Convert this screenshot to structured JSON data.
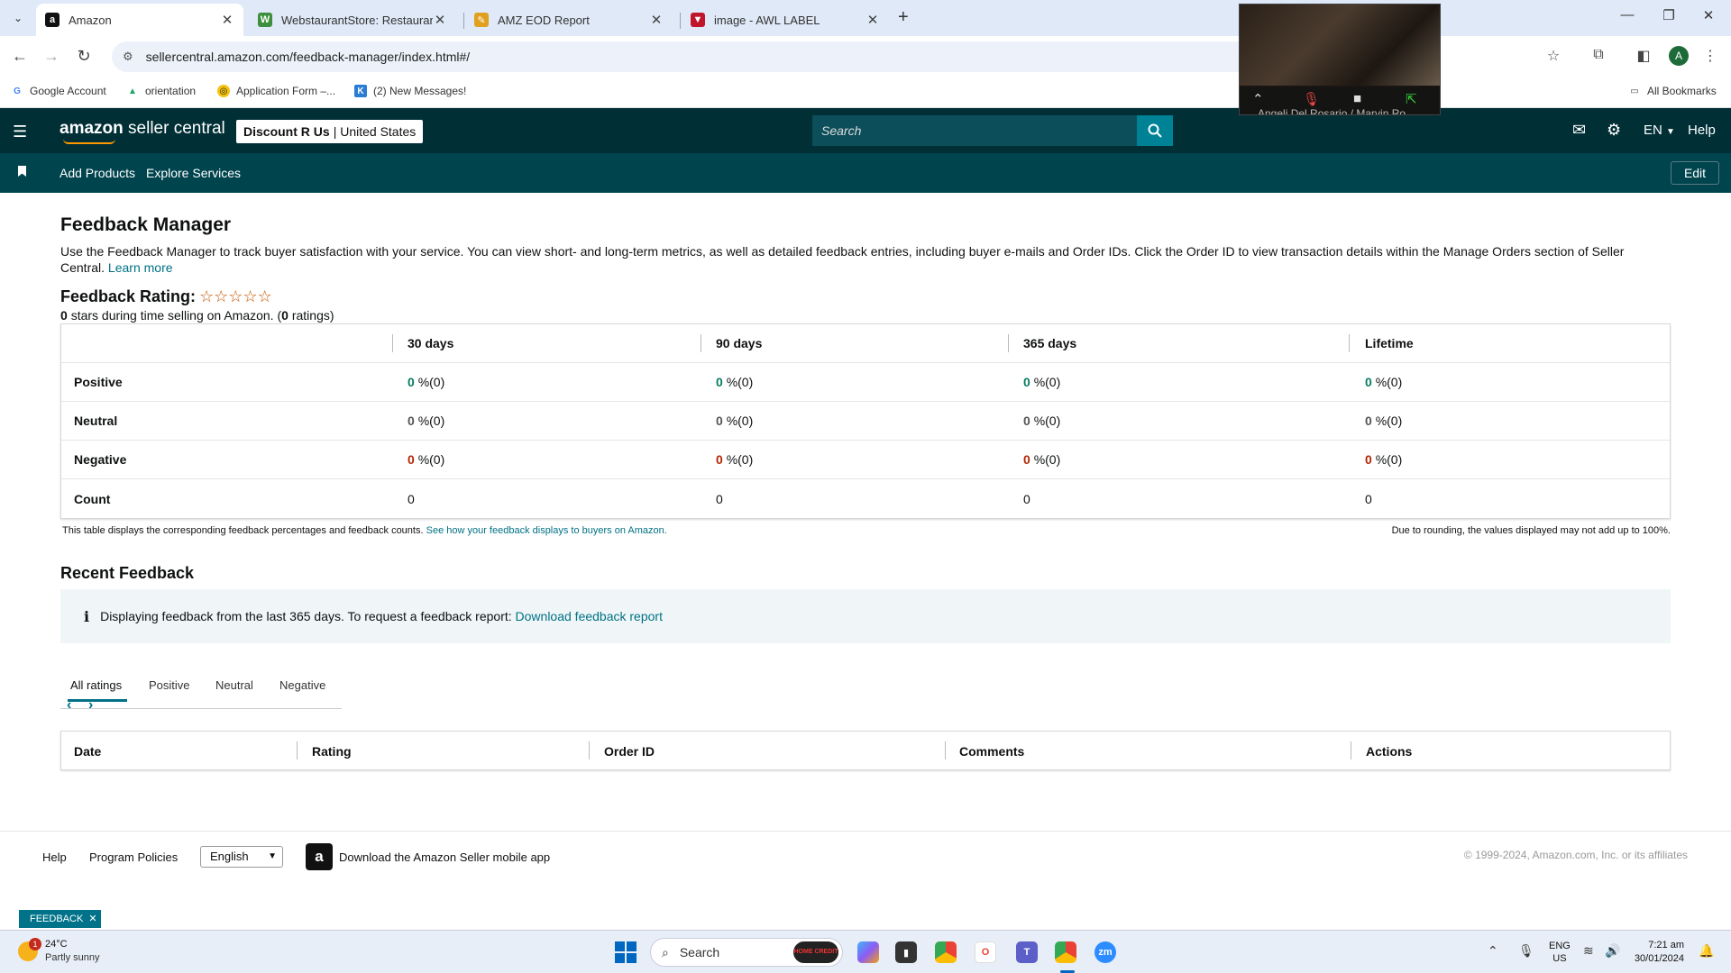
{
  "browser": {
    "tabs": [
      {
        "title": "Amazon",
        "favicon": "a",
        "favicon_color": "#111111",
        "active": true
      },
      {
        "title": "WebstaurantStore: Restaurant S",
        "favicon": "W",
        "favicon_color": "#3c8f3c",
        "active": false
      },
      {
        "title": "AMZ EOD Report",
        "favicon": "✎",
        "favicon_color": "#e0a020",
        "active": false
      },
      {
        "title": "image - AWL LABEL",
        "favicon": "▼",
        "favicon_color": "#c0152b",
        "active": false
      }
    ],
    "new_tab": "+",
    "url": "sellercentral.amazon.com/feedback-manager/index.html#/",
    "profile_initial": "A",
    "bookmarks": [
      "Google Account",
      "orientation",
      "Application Form –...",
      "(2) New Messages!"
    ],
    "all_bookmarks": "All Bookmarks"
  },
  "zoom_overlay": {
    "participants": "Angeli Del Rosario / Marvin Ro..."
  },
  "header": {
    "logo_primary": "amazon",
    "logo_secondary": "seller central",
    "store_name": "Discount R Us",
    "store_region": "United States",
    "search_placeholder": "Search",
    "language": "EN",
    "help": "Help"
  },
  "subnav": {
    "links": [
      "Add Products",
      "Explore Services"
    ],
    "edit": "Edit"
  },
  "page": {
    "title": "Feedback Manager",
    "description": "Use the Feedback Manager to track buyer satisfaction with your service. You can view short- and long-term metrics, as well as detailed feedback entries, including buyer e-mails and Order IDs. Click the Order ID to view transaction details within the Manage Orders section of Seller Central.",
    "learn_more": "Learn more",
    "rating_title": "Feedback Rating:",
    "stars": "☆☆☆☆☆",
    "rating_stars_value": "0",
    "rating_mid": "stars during time selling on Amazon. (",
    "rating_count": "0",
    "rating_end": "ratings)"
  },
  "feedback_table": {
    "columns": [
      "30 days",
      "90 days",
      "365 days",
      "Lifetime"
    ],
    "rows": [
      {
        "label": "Positive",
        "kind": "pos",
        "values": [
          "0",
          "0",
          "0",
          "0"
        ],
        "counts": [
          "%(0)",
          "%(0)",
          "%(0)",
          "%(0)"
        ]
      },
      {
        "label": "Neutral",
        "kind": "neu",
        "values": [
          "0",
          "0",
          "0",
          "0"
        ],
        "counts": [
          "%(0)",
          "%(0)",
          "%(0)",
          "%(0)"
        ]
      },
      {
        "label": "Negative",
        "kind": "neg",
        "values": [
          "0",
          "0",
          "0",
          "0"
        ],
        "counts": [
          "%(0)",
          "%(0)",
          "%(0)",
          "%(0)"
        ]
      },
      {
        "label": "Count",
        "kind": "count",
        "values": [
          "0",
          "0",
          "0",
          "0"
        ],
        "counts": [
          "",
          "",
          "",
          ""
        ]
      }
    ],
    "note_left": "This table displays the corresponding feedback percentages and feedback counts.",
    "note_link": "See how your feedback displays to buyers on Amazon.",
    "note_right": "Due to rounding, the values displayed may not add up to 100%."
  },
  "recent_feedback": {
    "title": "Recent Feedback",
    "info_text": "Displaying feedback from the last 365 days. To request a feedback report:",
    "info_link": "Download feedback report",
    "tabs": [
      "All ratings",
      "Positive",
      "Neutral",
      "Negative"
    ],
    "columns": [
      "Date",
      "Rating",
      "Order ID",
      "Comments",
      "Actions"
    ]
  },
  "footer": {
    "help": "Help",
    "program_policies": "Program Policies",
    "language": "English",
    "app_text": "Download the Amazon Seller mobile app",
    "copyright": "© 1999-2024, Amazon.com, Inc. or its affiliates",
    "feedback_chip": "FEEDBACK"
  },
  "taskbar": {
    "temperature": "24°C",
    "weather": "Partly sunny",
    "weather_badge": "1",
    "search": "Search",
    "promo": "HOME CREDIT",
    "lang_line1": "ENG",
    "lang_line2": "US",
    "time": "7:21 am",
    "date": "30/01/2024"
  },
  "colors": {
    "header_bg": "#002f36",
    "subnav_bg": "#00444e",
    "link": "#007185",
    "positive": "#067d62",
    "negative": "#b12704",
    "star": "#c45500"
  }
}
